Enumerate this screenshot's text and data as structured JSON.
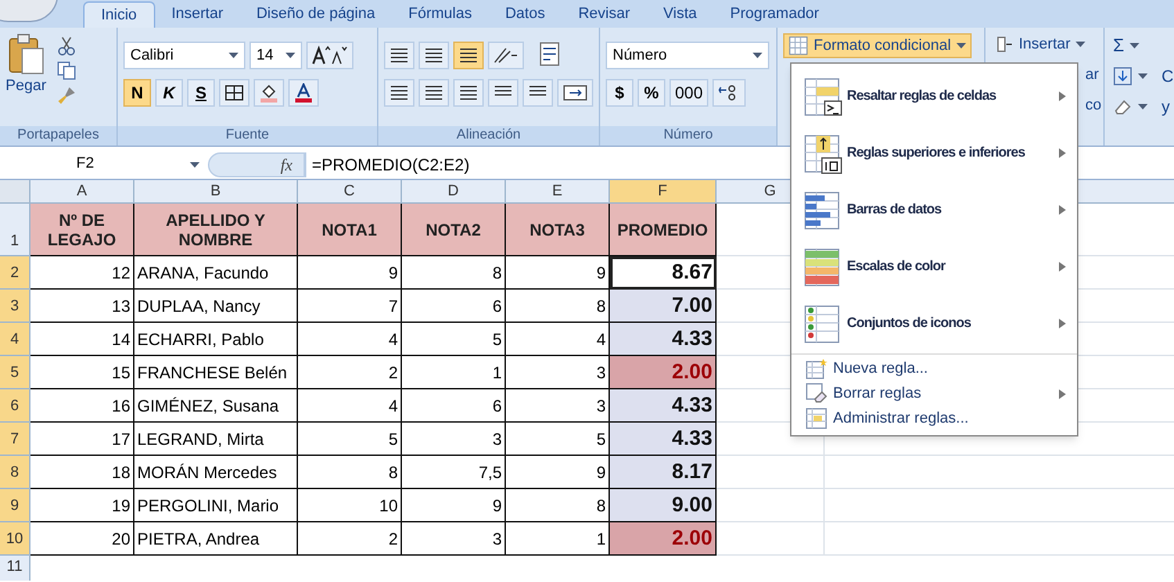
{
  "tabs": [
    {
      "label": "Inicio",
      "selected": true
    },
    {
      "label": "Insertar",
      "selected": false
    },
    {
      "label": "Diseño de página",
      "selected": false
    },
    {
      "label": "Fórmulas",
      "selected": false
    },
    {
      "label": "Datos",
      "selected": false
    },
    {
      "label": "Revisar",
      "selected": false
    },
    {
      "label": "Vista",
      "selected": false
    },
    {
      "label": "Programador",
      "selected": false
    }
  ],
  "ribbon": {
    "clipboard": {
      "paste": "Pegar",
      "label": "Portapapeles"
    },
    "font": {
      "name": "Calibri",
      "size": "14",
      "bold": "N",
      "italic": "K",
      "underline": "S",
      "bold_active": true,
      "label": "Fuente"
    },
    "alignment": {
      "bottom_align_active": true,
      "label": "Alineación"
    },
    "number": {
      "format": "Número",
      "currency": "$",
      "percent": "%",
      "thousands": "000",
      "label": "Número"
    },
    "styles": {
      "conditional": "Formato condicional",
      "open": true
    },
    "cells": {
      "insert": "Insertar",
      "delete_partial": "ar",
      "format_partial": "co"
    },
    "editing": {
      "sum": "Σ",
      "partial_1": "C",
      "partial_2": "y"
    }
  },
  "formula_bar": {
    "cell": "F2",
    "fx": "fx",
    "formula": "=PROMEDIO(C2:E2)"
  },
  "sheet": {
    "columns": [
      {
        "label": "A",
        "selected": false
      },
      {
        "label": "B",
        "selected": false
      },
      {
        "label": "C",
        "selected": false
      },
      {
        "label": "D",
        "selected": false
      },
      {
        "label": "E",
        "selected": false
      },
      {
        "label": "F",
        "selected": true
      },
      {
        "label": "G",
        "selected": false
      }
    ],
    "header_row": "1",
    "headers": [
      "Nº DE LEGAJO",
      "APELLIDO Y NOMBRE",
      "NOTA1",
      "NOTA2",
      "NOTA3",
      "PROMEDIO"
    ],
    "rows": [
      {
        "row": "2",
        "legajo": "12",
        "name": "ARANA, Facundo",
        "nota1": "9",
        "nota2": "8",
        "nota3": "9",
        "promedio": "8.67",
        "low": false,
        "selected": true
      },
      {
        "row": "3",
        "legajo": "13",
        "name": "DUPLAA, Nancy",
        "nota1": "7",
        "nota2": "6",
        "nota3": "8",
        "promedio": "7.00",
        "low": false,
        "selected": false
      },
      {
        "row": "4",
        "legajo": "14",
        "name": "ECHARRI, Pablo",
        "nota1": "4",
        "nota2": "5",
        "nota3": "4",
        "promedio": "4.33",
        "low": false,
        "selected": false
      },
      {
        "row": "5",
        "legajo": "15",
        "name": "FRANCHESE Belén",
        "nota1": "2",
        "nota2": "1",
        "nota3": "3",
        "promedio": "2.00",
        "low": true,
        "selected": false
      },
      {
        "row": "6",
        "legajo": "16",
        "name": "GIMÉNEZ, Susana",
        "nota1": "4",
        "nota2": "6",
        "nota3": "3",
        "promedio": "4.33",
        "low": false,
        "selected": false
      },
      {
        "row": "7",
        "legajo": "17",
        "name": "LEGRAND, Mirta",
        "nota1": "5",
        "nota2": "3",
        "nota3": "5",
        "promedio": "4.33",
        "low": false,
        "selected": false
      },
      {
        "row": "8",
        "legajo": "18",
        "name": "MORÁN Mercedes",
        "nota1": "8",
        "nota2": "7,5",
        "nota3": "9",
        "promedio": "8.17",
        "low": false,
        "selected": false
      },
      {
        "row": "9",
        "legajo": "19",
        "name": "PERGOLINI, Mario",
        "nota1": "10",
        "nota2": "9",
        "nota3": "8",
        "promedio": "9.00",
        "low": false,
        "selected": false
      },
      {
        "row": "10",
        "legajo": "20",
        "name": "PIETRA, Andrea",
        "nota1": "2",
        "nota2": "3",
        "nota3": "1",
        "promedio": "2.00",
        "low": true,
        "selected": false
      }
    ],
    "empty_row": "11"
  },
  "menu": {
    "items": [
      {
        "kind": "large",
        "label": "Resaltar reglas de celdas",
        "submenu": true
      },
      {
        "kind": "large",
        "label": "Reglas superiores e inferiores",
        "submenu": true
      },
      {
        "kind": "large",
        "label": "Barras de datos",
        "submenu": true
      },
      {
        "kind": "large",
        "label": "Escalas de color",
        "submenu": true
      },
      {
        "kind": "large",
        "label": "Conjuntos de iconos",
        "submenu": true
      },
      {
        "kind": "small",
        "label": "Nueva regla...",
        "submenu": false
      },
      {
        "kind": "small",
        "label": "Borrar reglas",
        "submenu": true
      },
      {
        "kind": "small",
        "label": "Administrar reglas...",
        "submenu": false
      }
    ]
  }
}
